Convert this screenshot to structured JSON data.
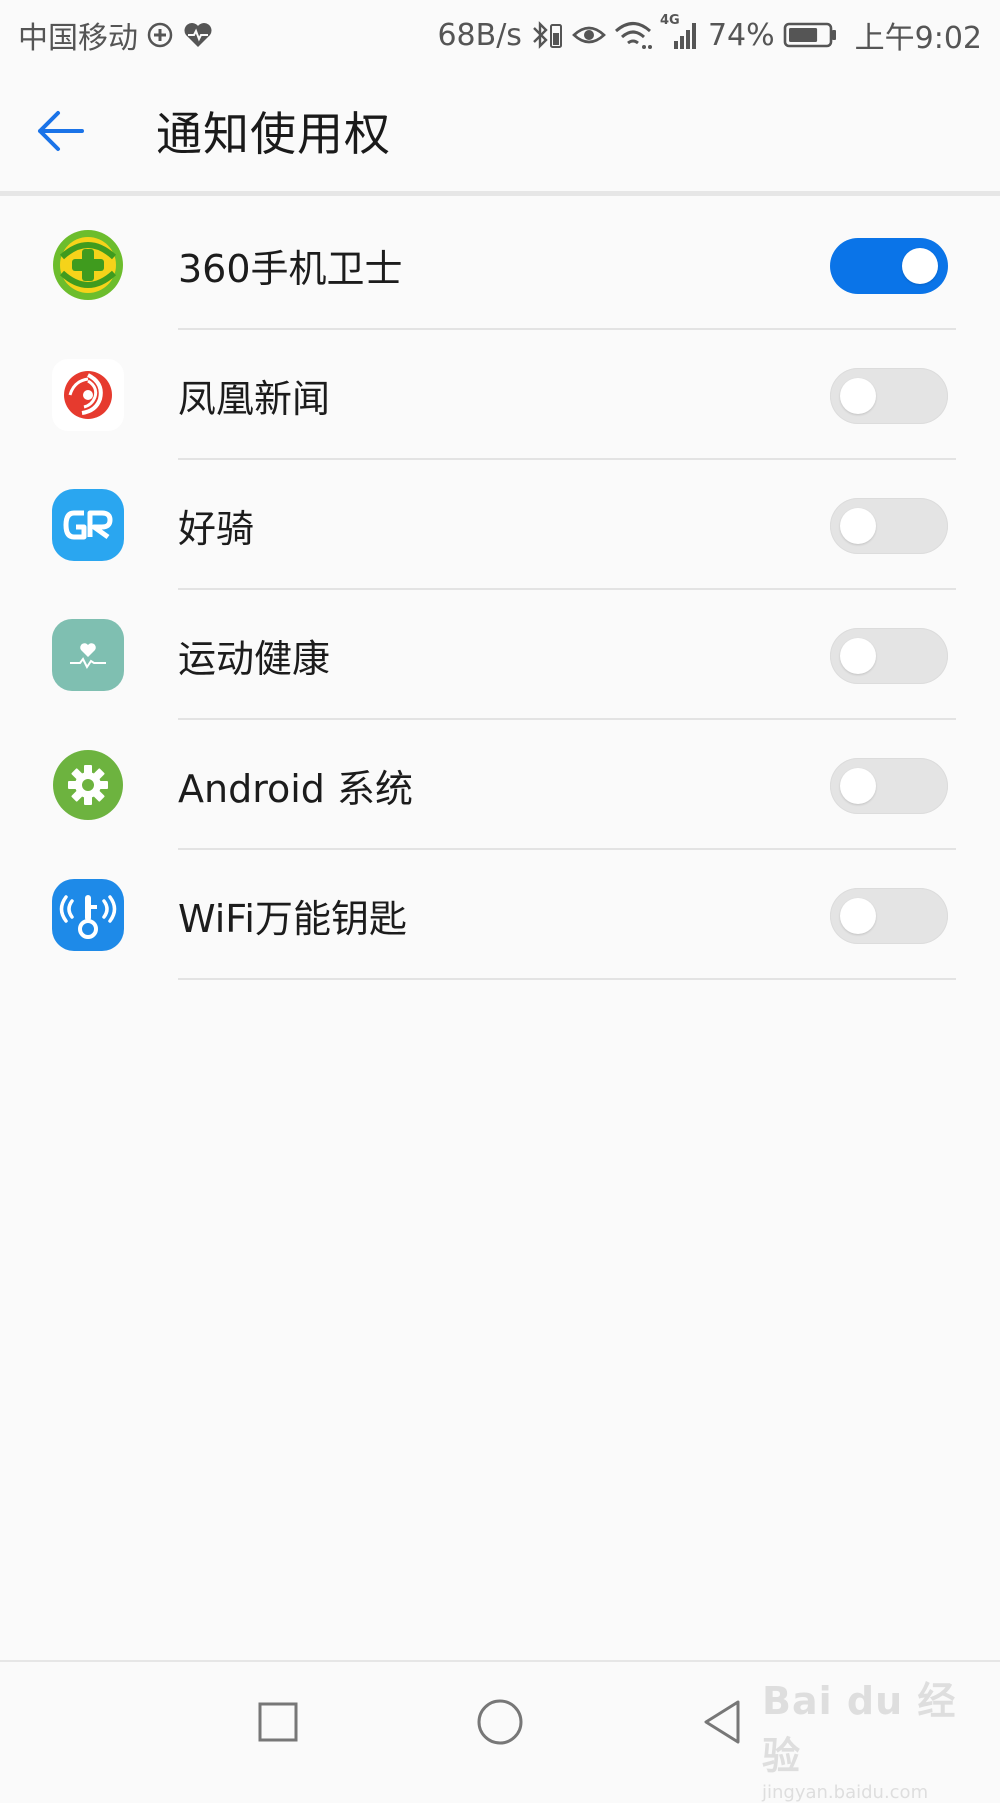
{
  "status_bar": {
    "carrier": "中国移动",
    "net_speed": "68B/s",
    "network_type": "4G",
    "battery_percent": "74%",
    "battery_level": 0.74,
    "time": "上午9:02",
    "icons": [
      "plus-circle-icon",
      "heart-pulse-icon",
      "bluetooth-icon",
      "eye-icon",
      "wifi-icon",
      "signal-icon",
      "battery-icon"
    ]
  },
  "app_bar": {
    "title": "通知使用权",
    "back_icon": "back-arrow-icon"
  },
  "apps": [
    {
      "name": "360手机卫士",
      "icon": "360-security-icon",
      "enabled": true
    },
    {
      "name": "凤凰新闻",
      "icon": "ifeng-news-icon",
      "enabled": false
    },
    {
      "name": "好骑",
      "icon": "haoqi-gr-icon",
      "enabled": false
    },
    {
      "name": "运动健康",
      "icon": "health-icon",
      "enabled": false
    },
    {
      "name": "Android 系统",
      "icon": "android-settings-gear-icon",
      "enabled": false
    },
    {
      "name": "WiFi万能钥匙",
      "icon": "wifi-key-icon",
      "enabled": false
    }
  ],
  "colors": {
    "accent": "#0a74e8",
    "toggle_off": "#e4e4e4",
    "background": "#fafafa"
  },
  "nav_bar": {
    "icons": [
      "recent-apps-square-icon",
      "home-circle-icon",
      "back-triangle-icon"
    ]
  },
  "watermark": {
    "main": "Bai du 经验",
    "sub": "jingyan.baidu.com"
  }
}
